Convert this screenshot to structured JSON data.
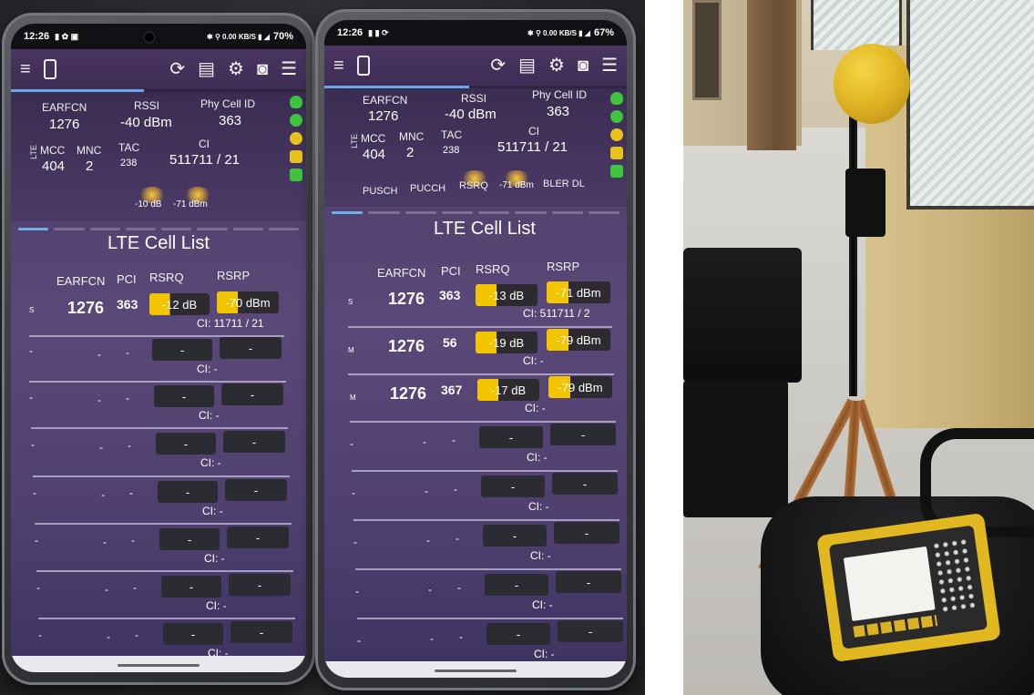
{
  "phone1": {
    "status": {
      "time": "12:26",
      "icons": "✱ ⚲ 0.00 KB/S ▮ ◢",
      "battery": "70%"
    },
    "serving": {
      "earfcn_label": "EARFCN",
      "earfcn": "1276",
      "rssi_label": "RSSI",
      "rssi": "-40 dBm",
      "phy_label": "Phy Cell ID",
      "phy": "363",
      "lte": "LTE",
      "mcc_label": "MCC",
      "mcc": "404",
      "mnc_label": "MNC",
      "mnc": "2",
      "tac_label": "TAC",
      "tac": "238",
      "ci_label": "CI",
      "ci": "511711 / 21",
      "rsrq_small": "-10 dB",
      "rsrp_small": "-71 dBm"
    },
    "cell_list": {
      "title": "LTE Cell List",
      "headers": {
        "earfcn": "EARFCN",
        "pci": "PCI",
        "rsrq": "RSRQ",
        "rsrp": "RSRP"
      },
      "rows": [
        {
          "tag": "S",
          "earfcn": "1276",
          "pci": "363",
          "rsrq": "-12 dB",
          "rsrp": "-70 dBm",
          "ci": "CI: 11711 / 21"
        },
        {
          "tag": "-",
          "earfcn": "-",
          "pci": "-",
          "rsrq": "-",
          "rsrp": "-",
          "ci": "CI: -"
        },
        {
          "tag": "-",
          "earfcn": "-",
          "pci": "-",
          "rsrq": "-",
          "rsrp": "-",
          "ci": "CI: -"
        },
        {
          "tag": "-",
          "earfcn": "-",
          "pci": "-",
          "rsrq": "-",
          "rsrp": "-",
          "ci": "CI: -"
        },
        {
          "tag": "-",
          "earfcn": "-",
          "pci": "-",
          "rsrq": "-",
          "rsrp": "-",
          "ci": "CI: -"
        },
        {
          "tag": "-",
          "earfcn": "-",
          "pci": "-",
          "rsrq": "-",
          "rsrp": "-",
          "ci": "CI: -"
        },
        {
          "tag": "-",
          "earfcn": "-",
          "pci": "-",
          "rsrq": "-",
          "rsrp": "-",
          "ci": "CI: -"
        },
        {
          "tag": "-",
          "earfcn": "-",
          "pci": "-",
          "rsrq": "-",
          "rsrp": "-",
          "ci": "CI: -"
        }
      ]
    }
  },
  "phone2": {
    "status": {
      "time": "12:26",
      "icons": "✱ ⚲ 0.00 KB/S ▮ ◢",
      "battery": "67%"
    },
    "serving": {
      "earfcn_label": "EARFCN",
      "earfcn": "1276",
      "rssi_label": "RSSI",
      "rssi": "-40 dBm",
      "phy_label": "Phy Cell ID",
      "phy": "363",
      "lte": "LTE",
      "mcc_label": "MCC",
      "mcc": "404",
      "mnc_label": "MNC",
      "mnc": "2",
      "tac_label": "TAC",
      "tac": "238",
      "ci_label": "CI",
      "ci": "511711 / 21",
      "pusch": "PUSCH",
      "pucch": "PUCCH",
      "rsrq_small": "RSRQ",
      "rsrp_small": "-71 dBm",
      "bler": "BLER DL"
    },
    "cell_list": {
      "title": "LTE Cell List",
      "headers": {
        "earfcn": "EARFCN",
        "pci": "PCI",
        "rsrq": "RSRQ",
        "rsrp": "RSRP"
      },
      "rows": [
        {
          "tag": "S",
          "earfcn": "1276",
          "pci": "363",
          "rsrq": "-13 dB",
          "rsrp": "-71 dBm",
          "ci": "CI: 511711 / 2"
        },
        {
          "tag": "M",
          "earfcn": "1276",
          "pci": "56",
          "rsrq": "-19 dB",
          "rsrp": "-79 dBm",
          "ci": "CI: -"
        },
        {
          "tag": "M",
          "earfcn": "1276",
          "pci": "367",
          "rsrq": "-17 dB",
          "rsrp": "-79 dBm",
          "ci": "CI: -"
        },
        {
          "tag": "-",
          "earfcn": "-",
          "pci": "-",
          "rsrq": "-",
          "rsrp": "-",
          "ci": "CI: -"
        },
        {
          "tag": "-",
          "earfcn": "-",
          "pci": "-",
          "rsrq": "-",
          "rsrp": "-",
          "ci": "CI: -"
        },
        {
          "tag": "-",
          "earfcn": "-",
          "pci": "-",
          "rsrq": "-",
          "rsrp": "-",
          "ci": "CI: -"
        },
        {
          "tag": "-",
          "earfcn": "-",
          "pci": "-",
          "rsrq": "-",
          "rsrp": "-",
          "ci": "CI: -"
        },
        {
          "tag": "-",
          "earfcn": "-",
          "pci": "-",
          "rsrq": "-",
          "rsrp": "-",
          "ci": "CI: -"
        }
      ]
    }
  },
  "colors": {
    "accent_yellow": "#f2c500",
    "signal_green": "#3ec43e",
    "header_purple": "#4a3560"
  },
  "icons": [
    "menu-icon",
    "refresh-icon",
    "log-icon",
    "settings-icon",
    "camera-icon",
    "sort-icon"
  ]
}
